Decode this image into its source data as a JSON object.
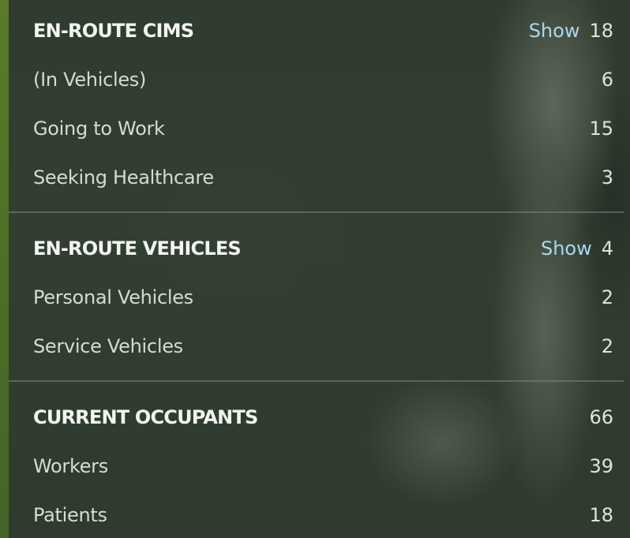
{
  "sections": [
    {
      "header": {
        "label": "EN-ROUTE CIMS",
        "show_label": "Show",
        "count": "18"
      },
      "rows": [
        {
          "label": "(In Vehicles)",
          "count": "6"
        },
        {
          "label": "Going to Work",
          "count": "15"
        },
        {
          "label": "Seeking Healthcare",
          "count": "3"
        }
      ]
    },
    {
      "header": {
        "label": "EN-ROUTE VEHICLES",
        "show_label": "Show",
        "count": "4"
      },
      "rows": [
        {
          "label": "Personal Vehicles",
          "count": "2"
        },
        {
          "label": "Service Vehicles",
          "count": "2"
        }
      ]
    },
    {
      "header": {
        "label": "CURRENT OCCUPANTS",
        "count": "66"
      },
      "rows": [
        {
          "label": "Workers",
          "count": "39"
        },
        {
          "label": "Patients",
          "count": "18"
        }
      ]
    }
  ],
  "colors": {
    "accent_link": "#a8d8ee",
    "header_text": "#f3f5f2",
    "row_text": "#d6dbd4"
  }
}
